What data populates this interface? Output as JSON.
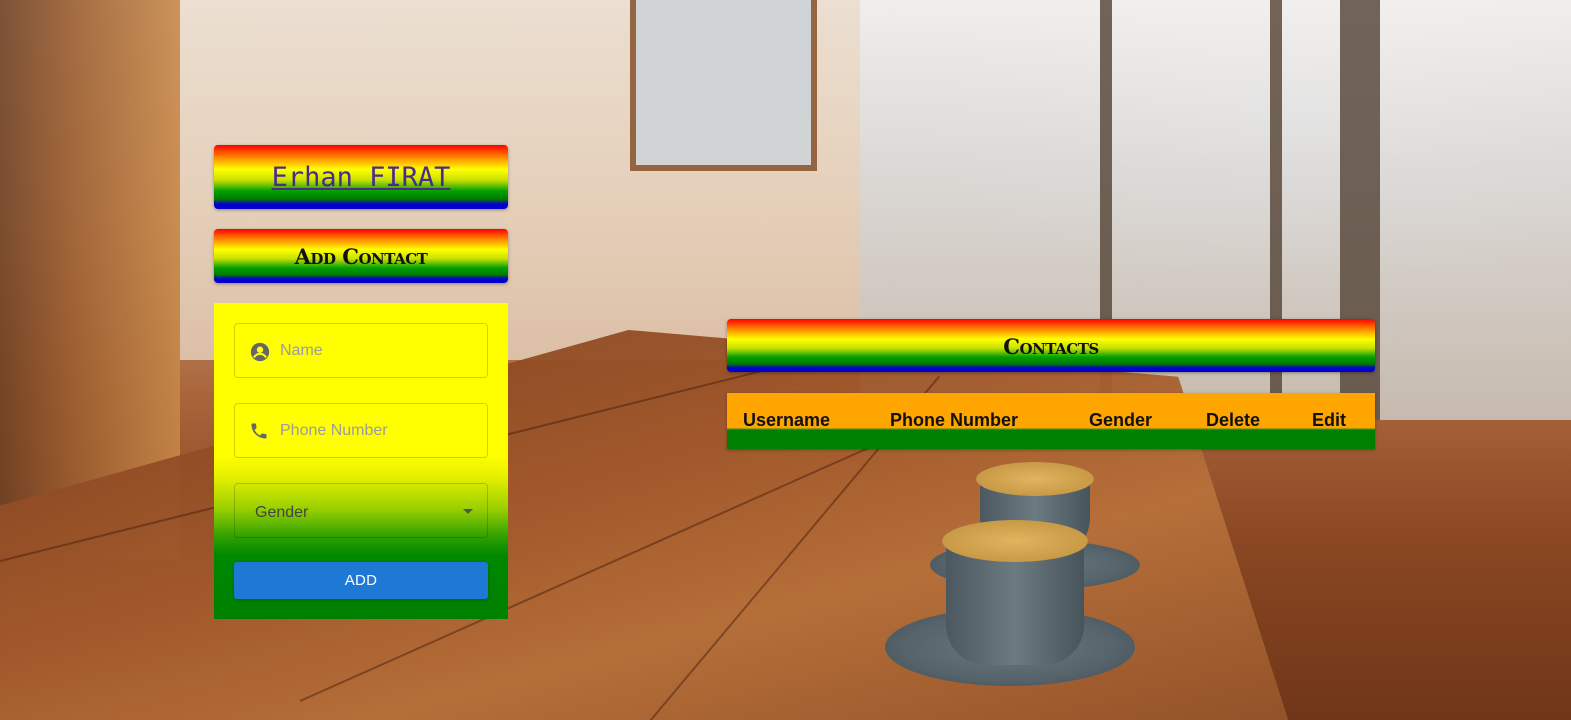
{
  "app": {
    "title": "Erhan FIRAT"
  },
  "add_contact": {
    "heading": "Add Contact",
    "name_placeholder": "Name",
    "phone_placeholder": "Phone Number",
    "gender_label": "Gender",
    "add_button_label": "ADD"
  },
  "contacts": {
    "heading": "Contacts",
    "columns": [
      "Username",
      "Phone Number",
      "Gender",
      "Delete",
      "Edit"
    ],
    "rows": []
  },
  "colors": {
    "form_top": "#ffff00",
    "form_bottom": "#008000",
    "button": "#1e78d6",
    "table_header": "#ffa500"
  },
  "icons": {
    "name_field": "account-circle-icon",
    "phone_field": "phone-icon",
    "gender_select": "chevron-down-icon"
  }
}
